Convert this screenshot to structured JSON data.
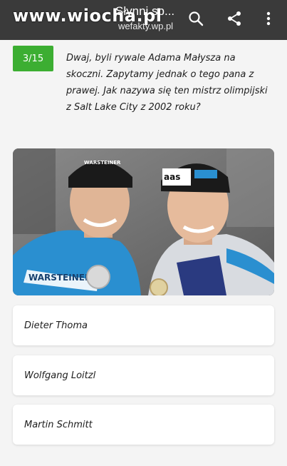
{
  "topbar": {
    "watermark": "www.wiocha.pl",
    "title": "Słynni sp...",
    "url": "wefakty.wp.pl",
    "icons": [
      "close-icon",
      "search-icon",
      "share-icon",
      "more-vert-icon"
    ]
  },
  "quiz": {
    "counter": "3/15",
    "question": "Dwaj, byli rywale Adama Małysza na skoczni. Zapytamy jednak o tego pana z prawej. Jak nazywa się ten mistrz olimpijski z Salt Lake City z 2002 roku?",
    "answers": [
      {
        "label": "Dieter Thoma"
      },
      {
        "label": "Wolfgang Loitzl"
      },
      {
        "label": "Martin Schmitt"
      }
    ]
  },
  "photo": {
    "cap_logo_left": "WARSTEINER",
    "cap_logo_right": "aas",
    "jacket_logo": "WARSTEINER"
  },
  "colors": {
    "badge": "#3cae32",
    "topbar": "#3a3a3a",
    "background": "#f4f4f4"
  }
}
